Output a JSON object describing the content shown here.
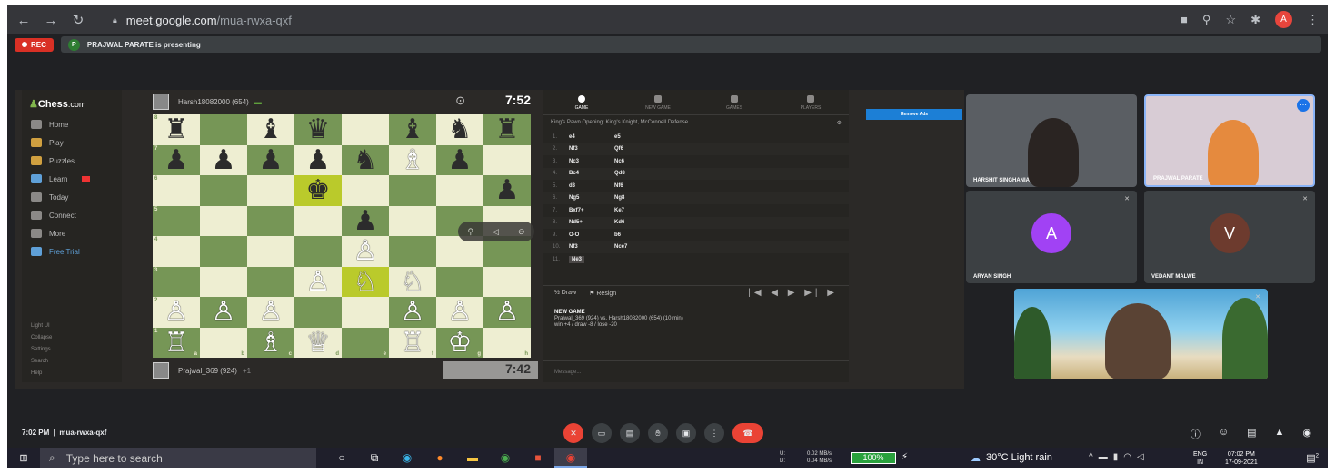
{
  "browser": {
    "url_host": "meet.google.com",
    "url_path": "/mua-rwxa-qxf",
    "profile_initial": "A"
  },
  "meet": {
    "rec_label": "REC",
    "presenter_initial": "P",
    "presenting_text": "PRAJWAL PARATE is presenting",
    "time": "7:02 PM",
    "code": "mua-rwxa-qxf"
  },
  "chess_sidebar": {
    "logo": "Chess",
    "logo_suffix": ".com",
    "items": [
      {
        "label": "Home",
        "icon": "home-icon"
      },
      {
        "label": "Play",
        "icon": "play-icon"
      },
      {
        "label": "Puzzles",
        "icon": "puzzle-icon"
      },
      {
        "label": "Learn",
        "icon": "learn-icon"
      },
      {
        "label": "Today",
        "icon": "today-icon"
      },
      {
        "label": "Connect",
        "icon": "connect-icon"
      },
      {
        "label": "More",
        "icon": "more-icon"
      },
      {
        "label": "Free Trial",
        "icon": "diamond-icon"
      }
    ],
    "bottom": [
      "Light UI",
      "Collapse",
      "Settings",
      "Search",
      "Help"
    ]
  },
  "game": {
    "top_player": "Harsh18082000",
    "top_rating": "(654)",
    "top_clock": "7:52",
    "bottom_player": "Prajwal_369",
    "bottom_rating": "(924)",
    "bottom_score": "+1",
    "bottom_clock": "7:42",
    "board": [
      [
        "r",
        "",
        "b",
        "q",
        "",
        "b",
        "n",
        "r"
      ],
      [
        "p",
        "p",
        "p",
        "p",
        "n",
        "B",
        "p",
        ""
      ],
      [
        "",
        "",
        "",
        "k",
        "",
        "",
        "",
        "p"
      ],
      [
        "",
        "",
        "",
        "",
        "p",
        "",
        "",
        ""
      ],
      [
        "",
        "",
        "",
        "",
        "P",
        "",
        "",
        ""
      ],
      [
        "",
        "",
        "",
        "P",
        "N",
        "N",
        "",
        ""
      ],
      [
        "P",
        "P",
        "P",
        "",
        "",
        "P",
        "P",
        "P"
      ],
      [
        "R",
        "",
        "B",
        "Q",
        "",
        "R",
        "K",
        ""
      ]
    ],
    "highlight_squares": [
      [
        2,
        3
      ],
      [
        5,
        4
      ]
    ],
    "files": [
      "a",
      "b",
      "c",
      "d",
      "e",
      "f",
      "g",
      "h"
    ],
    "ranks": [
      "8",
      "7",
      "6",
      "5",
      "4",
      "3",
      "2",
      "1"
    ]
  },
  "moves_panel": {
    "tabs": [
      "GAME",
      "NEW GAME",
      "GAMES",
      "PLAYERS"
    ],
    "opening": "King's Pawn Opening: King's Knight, McConnell Defense",
    "moves": [
      {
        "n": "1.",
        "w": "e4",
        "b": "e5"
      },
      {
        "n": "2.",
        "w": "Nf3",
        "b": "Qf6"
      },
      {
        "n": "3.",
        "w": "Nc3",
        "b": "Nc6"
      },
      {
        "n": "4.",
        "w": "Bc4",
        "b": "Qd8"
      },
      {
        "n": "5.",
        "w": "d3",
        "b": "Nf6"
      },
      {
        "n": "6.",
        "w": "Ng5",
        "b": "Ng8"
      },
      {
        "n": "7.",
        "w": "Bxf7+",
        "b": "Ke7"
      },
      {
        "n": "8.",
        "w": "Nd5+",
        "b": "Kd6"
      },
      {
        "n": "9.",
        "w": "O-O",
        "b": "b6"
      },
      {
        "n": "10.",
        "w": "Nf3",
        "b": "Nce7"
      },
      {
        "n": "11.",
        "w": "Ne3",
        "b": ""
      }
    ],
    "draw": "Draw",
    "resign": "Resign",
    "new_game_title": "NEW GAME",
    "new_game_line": "Prajwal_369 (924) vs. Harsh18082000 (654) (10 min)",
    "new_game_stats": "win +4 / draw -8 / lose -20",
    "message_placeholder": "Message...",
    "remove_ads": "Remove Ads"
  },
  "participants": [
    {
      "name": "HARSHIT SINGHANIA",
      "type": "video",
      "color": "#5a5e63"
    },
    {
      "name": "PRAJWAL PARATE",
      "type": "video",
      "color": "#d8ccd5"
    },
    {
      "name": "ARYAN SINGH",
      "type": "avatar",
      "initial": "A",
      "color": "#a142f4"
    },
    {
      "name": "VEDANT MALWE",
      "type": "avatar",
      "initial": "V",
      "color": "#6d3b2e"
    }
  ],
  "taskbar": {
    "search_placeholder": "Type here to search",
    "net_up_label": "U:",
    "net_down_label": "D:",
    "net_up": "0.02 MB/s",
    "net_down": "0.04 MB/s",
    "battery": "100%",
    "weather": "30°C Light rain",
    "lang_top": "ENG",
    "lang_bottom": "IN",
    "clock_time": "07:02 PM",
    "clock_date": "17-09-2021",
    "notif_count": "2"
  }
}
